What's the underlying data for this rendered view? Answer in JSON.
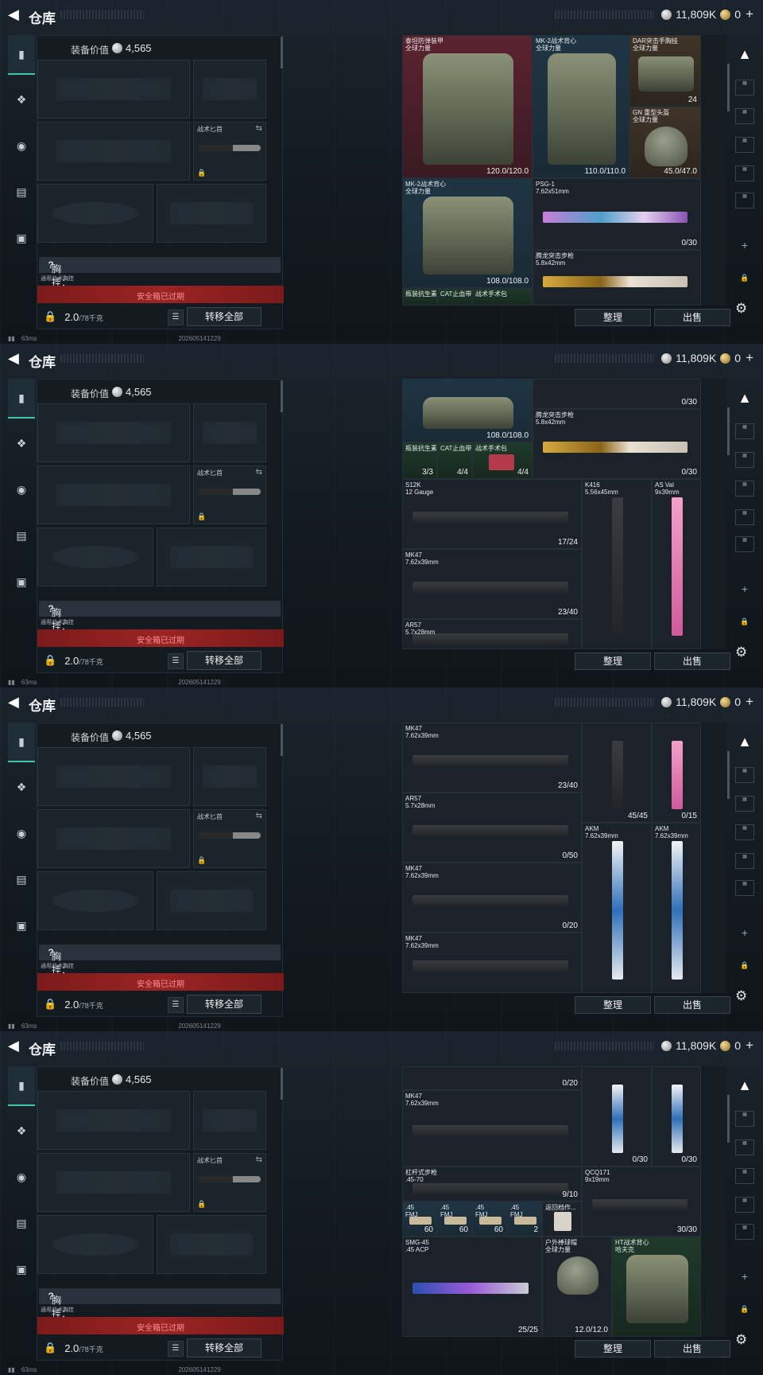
{
  "header": {
    "title": "仓库",
    "balance": "11,809K",
    "gold": "0"
  },
  "loadout": {
    "value_label": "装备价值",
    "value": "4,565",
    "knife_label": "战术匕首",
    "rig_label": "胸挂：0/9",
    "rig_help": "?",
    "rig_sub": "通用战术胸挂",
    "secure_label": "安全箱已过期",
    "weight": "2.0",
    "weight_max": "/78千克",
    "transfer_label": "转移全部"
  },
  "status": {
    "ping": "63ms",
    "timestamp": "202605141229"
  },
  "actions": {
    "sort": "整理",
    "sell": "出售"
  },
  "frames": [
    {
      "cells": [
        {
          "name": "泰坦防弹装甲\n全球力量",
          "dur": "120.0/120.0"
        },
        {
          "name": "MK-2战术背心\n全球力量",
          "dur": "110.0/110.0"
        },
        {
          "name": "DAR突击手胸挂\n全球力量",
          "dur": "24"
        },
        {
          "name": "GN 重型头盔\n全球力量",
          "dur": "45.0/47.0"
        },
        {
          "name": "MK-2战术背心\n全球力量",
          "dur": "108.0/108.0"
        },
        {
          "name": "PSG-1\n7.62x51mm",
          "dur": "0/30"
        },
        {
          "name": "腾龙突击步枪\n5.8x42mm",
          "dur": ""
        },
        {
          "name": "瓶装抗生素",
          "dur": ""
        },
        {
          "name": "CAT止血带",
          "dur": ""
        },
        {
          "name": "战术手术包",
          "dur": ""
        }
      ]
    },
    {
      "cells": [
        {
          "name": "",
          "dur": "108.0/108.0"
        },
        {
          "name": "",
          "dur": "0/30"
        },
        {
          "name": "腾龙突击步枪\n5.8x42mm",
          "dur": "0/30"
        },
        {
          "name": "瓶装抗生素",
          "dur": "3/3"
        },
        {
          "name": "CAT止血带",
          "dur": "4/4"
        },
        {
          "name": "战术手术包",
          "dur": "4/4"
        },
        {
          "name": "S12K\n12 Gauge",
          "dur": "17/24"
        },
        {
          "name": "K416\n5.56x45mm",
          "dur": ""
        },
        {
          "name": "AS Val\n9x39mm",
          "dur": ""
        },
        {
          "name": "MK47\n7.62x39mm",
          "dur": "23/40"
        },
        {
          "name": "AR57\n5.7x28mm",
          "dur": ""
        }
      ]
    },
    {
      "cells": [
        {
          "name": "MK47\n7.62x39mm",
          "dur": "23/40"
        },
        {
          "name": "",
          "dur": "45/45"
        },
        {
          "name": "",
          "dur": "0/15"
        },
        {
          "name": "AR57\n5.7x28mm",
          "dur": "0/50"
        },
        {
          "name": "AKM\n7.62x39mm",
          "dur": ""
        },
        {
          "name": "AKM\n7.62x39mm",
          "dur": ""
        },
        {
          "name": "MK47\n7.62x39mm",
          "dur": "0/20"
        },
        {
          "name": "MK47\n7.62x39mm",
          "dur": ""
        }
      ]
    },
    {
      "cells": [
        {
          "name": "",
          "dur": "0/20"
        },
        {
          "name": "",
          "dur": "0/30"
        },
        {
          "name": "",
          "dur": "0/30"
        },
        {
          "name": "MK47\n7.62x39mm",
          "dur": ""
        },
        {
          "name": "杠杆式步枪\n.45-70",
          "dur": "9/10"
        },
        {
          "name": "QCQ171\n9x19mm",
          "dur": "30/30"
        },
        {
          "name": ".45\nFMJ",
          "dur": "60"
        },
        {
          "name": ".45\nFMJ",
          "dur": "60"
        },
        {
          "name": ".45\nFMJ",
          "dur": "60"
        },
        {
          "name": ".45\nFMJ",
          "dur": "2"
        },
        {
          "name": "返回档作...",
          "dur": ""
        },
        {
          "name": "SMG-45\n.45 ACP",
          "dur": "25/25"
        },
        {
          "name": "户外棒球帽\n全球力量",
          "dur": "12.0/12.0"
        },
        {
          "name": "HT战术背心\n哈夫克",
          "dur": ""
        }
      ]
    }
  ]
}
